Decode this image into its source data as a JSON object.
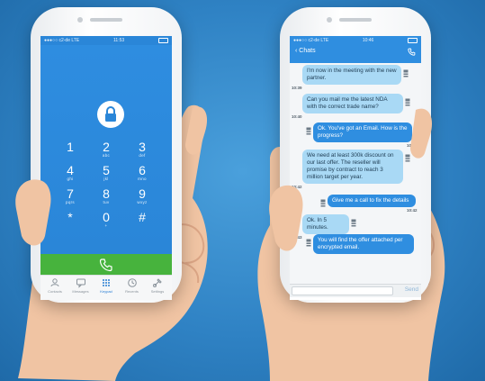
{
  "dialer": {
    "status_time": "11:53",
    "status_left": "●●●○○ c2-de  LTE",
    "keys": [
      {
        "num": "1",
        "letters": ""
      },
      {
        "num": "2",
        "letters": "abc"
      },
      {
        "num": "3",
        "letters": "def"
      },
      {
        "num": "4",
        "letters": "ghi"
      },
      {
        "num": "5",
        "letters": "jkl"
      },
      {
        "num": "6",
        "letters": "mno"
      },
      {
        "num": "7",
        "letters": "pqrs"
      },
      {
        "num": "8",
        "letters": "tuv"
      },
      {
        "num": "9",
        "letters": "wxyz"
      },
      {
        "num": "*",
        "letters": ""
      },
      {
        "num": "0",
        "letters": "+"
      },
      {
        "num": "#",
        "letters": ""
      }
    ],
    "tabs": [
      {
        "label": "Contacts",
        "icon": "contacts-icon"
      },
      {
        "label": "Messages",
        "icon": "messages-icon"
      },
      {
        "label": "Keypad",
        "icon": "keypad-icon"
      },
      {
        "label": "Recents",
        "icon": "recents-icon"
      },
      {
        "label": "Settings",
        "icon": "settings-icon"
      }
    ],
    "active_tab": "Keypad",
    "colors": {
      "accent": "#2a86d8",
      "call": "#47b33d"
    }
  },
  "chat": {
    "status_time": "10:46",
    "status_left": "●●●○○ c2-de  LTE",
    "back_label": "Chats",
    "messages": [
      {
        "dir": "in",
        "text": "I'm now in the meeting with the new partner.",
        "time": "10:39"
      },
      {
        "dir": "in",
        "text": "Can you mail me the latest NDA with the correct trade name?",
        "time": "10:40"
      },
      {
        "dir": "out",
        "text": "Ok. You've got an Email. How is the progress?",
        "time": "10:41"
      },
      {
        "dir": "in",
        "text": "We need at least 300k discount on our last offer. The reseller will promise by contract to reach 3 million target per year.",
        "time": "10:42"
      },
      {
        "dir": "out",
        "text": "Give me a call to fix the details",
        "time": "10:42"
      },
      {
        "dir": "in",
        "text": "Ok. In 5 minutes.",
        "time": "10:43"
      },
      {
        "dir": "out",
        "text": "You will find the offer attached per encrypted email.",
        "time": ""
      }
    ],
    "send_label": "Send",
    "colors": {
      "incoming": "#a9d9f5",
      "outgoing": "#2f8ee0"
    }
  }
}
